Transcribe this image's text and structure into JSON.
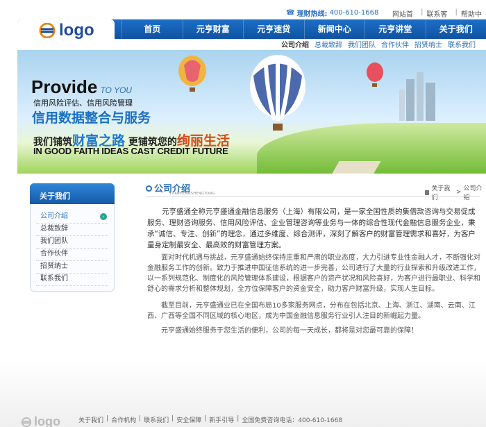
{
  "top": {
    "hotline_label": "理财热线:",
    "hotline_number": "400-610-1668",
    "links": [
      "网站首页",
      "联系客服",
      "帮助中心"
    ]
  },
  "logo": "logo",
  "nav": [
    "首页",
    "元亨财富",
    "元亨速贷",
    "新闻中心",
    "元亨讲堂",
    "关于我们"
  ],
  "subnav": [
    "公司介绍",
    "总裁致辞",
    "我们团队",
    "合作伙伴",
    "招贤纳士",
    "联系我们"
  ],
  "banner": {
    "provide": "Provide",
    "to_you": "TO YOU",
    "sub1": "信用风险评估、信用风险管理",
    "sub2": "信用数据整合与服务",
    "line3_a": "我们铺筑",
    "line3_b": "财富之路",
    "line3_c": "更铺筑您的",
    "line3_d": "绚丽生活",
    "english": "IN GOOD FAITH IDEAS CAST CREDIT FUTURE"
  },
  "sidebar": {
    "title": "关于我们",
    "items": [
      "公司介绍",
      "总裁致辞",
      "我们团队",
      "合作伙伴",
      "招贤纳士",
      "联系我们"
    ]
  },
  "main": {
    "title": "公司介绍",
    "subtitle": "YUANHENGSHENGTONG",
    "breadcrumb": [
      "关于我们",
      "公司介绍"
    ],
    "paragraphs": [
      "元亨盛通全称元亨盛通金融信息服务（上海）有限公司，是一家全国性质的集借款咨询与交易促成服务、理财咨询服务、信用风险评估、企业管理咨询等业务与一体的综合性现代金融信息服务企业，秉承“诚信、专注、创新”的理念，通过多维度、综合测评，深刻了解客户的财富管理需求和喜好，为客户量身定制最安全、最高效的财富管理方案。",
      "面对时代机遇与挑战，元亨盛通始终保持庄重和严肃的职业态度，大力引进专业性金融人才，不断强化对金融服务工作的创新。致力于推进中国征信系统的进一步完善，公司进行了大量的行业探索和升级改进工作，以一系列规范化、制度化的风险管理体系建设，根据客户的资产状况和风险喜好，为客户进行最职业、科学和舒心的需求分析和整体规划，全方位保障客户的资金安全，助力客户财富升级，实现人生目标。",
      "截至目前，元亨盛通业已在全国布局10多家服务网点，分布在包括北京、上海、浙江、湖南、云南、江西、广西等全国不同区域的核心地区，成为中国金融信息服务行业引人注目的新崛起力量。",
      "元亨盛通始终服务于您生活的便利，公司的每一天成长，都将是对您最可靠的保障！"
    ]
  },
  "footer": {
    "logo": "logo",
    "links": [
      "关于我们",
      "合作机构",
      "联系我们",
      "安全保障",
      "新手引导",
      "全国免费咨询电话：400-610-1668"
    ]
  },
  "colors": {
    "brand_blue": "#1d6fc7",
    "accent_orange": "#d64b1a"
  }
}
